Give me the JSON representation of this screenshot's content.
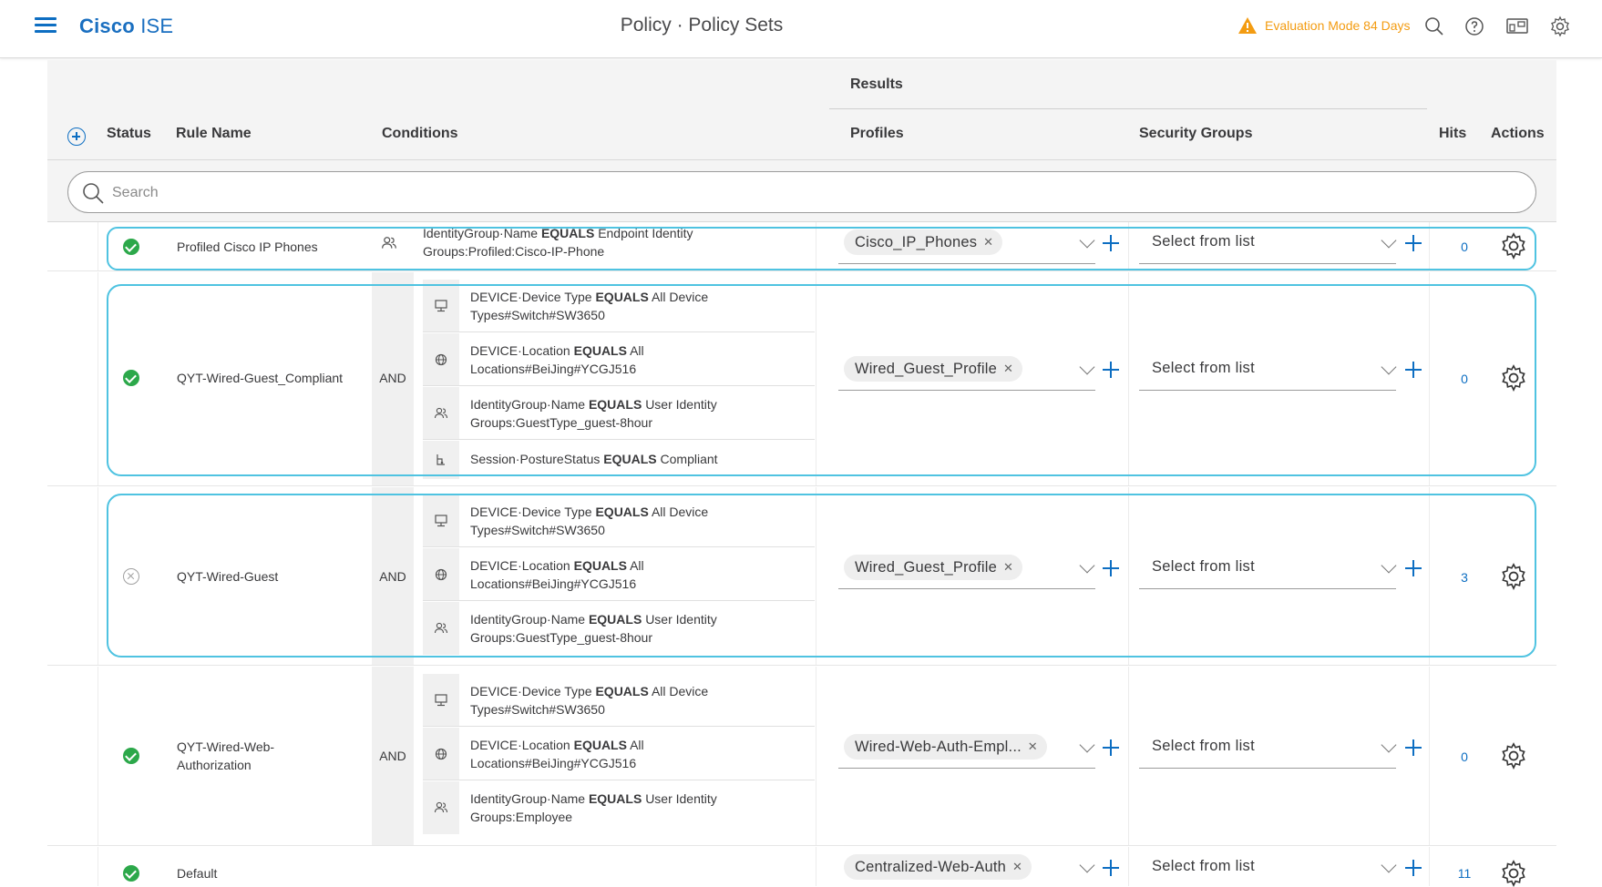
{
  "header": {
    "brand_bold": "Cisco",
    "brand_rest": " ISE",
    "title": "Policy · Policy Sets",
    "eval_text": "Evaluation Mode 84 Days"
  },
  "table": {
    "headers": {
      "results": "Results",
      "status": "Status",
      "rule_name": "Rule Name",
      "conditions": "Conditions",
      "profiles": "Profiles",
      "security_groups": "Security Groups",
      "hits": "Hits",
      "actions": "Actions"
    },
    "search_placeholder": "Search"
  },
  "rows": [
    {
      "status": "enabled",
      "name": "Profiled Cisco IP Phones",
      "operator": "",
      "conditions": [
        {
          "icon": "user-group-icon",
          "attr": "IdentityGroup·Name",
          "op": "EQUALS",
          "value": "Endpoint Identity Groups:Profiled:Cisco-IP-Phone"
        }
      ],
      "profile": "Cisco_IP_Phones",
      "security_group": "Select from list",
      "hits": "0"
    },
    {
      "status": "enabled",
      "name": "QYT-Wired-Guest_Compliant",
      "operator": "AND",
      "conditions": [
        {
          "icon": "device-type-icon",
          "attr": "DEVICE·Device Type",
          "op": "EQUALS",
          "value": "All Device Types#Switch#SW3650"
        },
        {
          "icon": "location-icon",
          "attr": "DEVICE·Location",
          "op": "EQUALS",
          "value": "All Locations#BeiJing#YCGJ516"
        },
        {
          "icon": "user-group-icon",
          "attr": "IdentityGroup·Name",
          "op": "EQUALS",
          "value": "User Identity Groups:GuestType_guest-8hour"
        },
        {
          "icon": "posture-icon",
          "attr": "Session·PostureStatus",
          "op": "EQUALS",
          "value": "Compliant"
        }
      ],
      "profile": "Wired_Guest_Profile",
      "security_group": "Select from list",
      "hits": "0"
    },
    {
      "status": "disabled",
      "name": "QYT-Wired-Guest",
      "operator": "AND",
      "conditions": [
        {
          "icon": "device-type-icon",
          "attr": "DEVICE·Device Type",
          "op": "EQUALS",
          "value": "All Device Types#Switch#SW3650"
        },
        {
          "icon": "location-icon",
          "attr": "DEVICE·Location",
          "op": "EQUALS",
          "value": "All Locations#BeiJing#YCGJ516"
        },
        {
          "icon": "user-group-icon",
          "attr": "IdentityGroup·Name",
          "op": "EQUALS",
          "value": "User Identity Groups:GuestType_guest-8hour"
        }
      ],
      "profile": "Wired_Guest_Profile",
      "security_group": "Select from list",
      "hits": "3"
    },
    {
      "status": "enabled",
      "name_line1": "QYT-Wired-Web-",
      "name_line2": "Authorization",
      "operator": "AND",
      "conditions": [
        {
          "icon": "device-type-icon",
          "attr": "DEVICE·Device Type",
          "op": "EQUALS",
          "value": "All Device Types#Switch#SW3650"
        },
        {
          "icon": "location-icon",
          "attr": "DEVICE·Location",
          "op": "EQUALS",
          "value": "All Locations#BeiJing#YCGJ516"
        },
        {
          "icon": "user-group-icon",
          "attr": "IdentityGroup·Name",
          "op": "EQUALS",
          "value": "User Identity Groups:Employee"
        }
      ],
      "profile": "Wired-Web-Auth-Empl...",
      "security_group": "Select from list",
      "hits": "0"
    },
    {
      "status": "enabled",
      "name": "Default",
      "operator": "",
      "conditions": [],
      "profile": "Centralized-Web-Auth",
      "security_group": "Select from list",
      "hits": "11"
    }
  ],
  "colors": {
    "accent": "#0d6ec2",
    "enabled": "#2ca84a",
    "warning": "#f39c12",
    "highlight": "#4fc3e1"
  }
}
